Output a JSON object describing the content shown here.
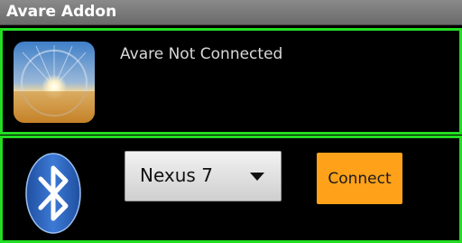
{
  "app": {
    "title": "Avare Addon"
  },
  "status": {
    "text": "Avare Not Connected",
    "icon": "avare-app-icon"
  },
  "connect": {
    "icon": "bluetooth-icon",
    "device_selected": "Nexus 7",
    "button_label": "Connect"
  },
  "colors": {
    "panel_border": "#22dd22",
    "button": "#ffa21a",
    "bluetooth": "#2c62b8"
  }
}
